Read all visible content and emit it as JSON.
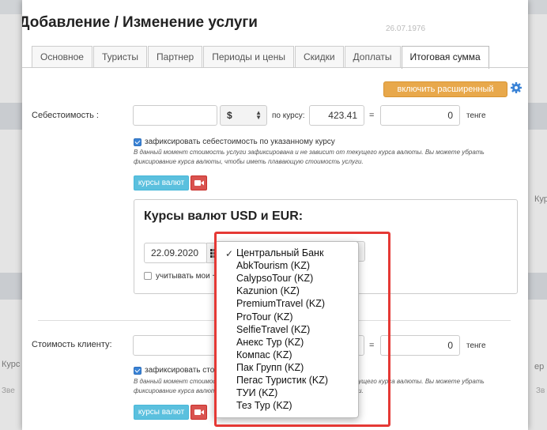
{
  "background": {
    "date": "26.07.1976",
    "left_label_1": "Кур",
    "left_label_2": "Курс",
    "left_label_3": "Зве",
    "right_label_1": "Кур",
    "right_label_2": "ер",
    "right_label_3": "Зв"
  },
  "modal": {
    "title": "Добавление / Изменение услуги",
    "tabs": [
      "Основное",
      "Туристы",
      "Партнер",
      "Периоды и цены",
      "Скидки",
      "Доплаты",
      "Итоговая сумма"
    ],
    "advanced_button": "включить расширенный режим"
  },
  "cost": {
    "label": "Себестоимость :",
    "amount": "",
    "currency": "$",
    "rate_label": "по курсу:",
    "rate": "423.41",
    "equals": "=",
    "total": "0",
    "total_currency": "тенге",
    "fix_label": "зафиксировать себестоимость по указанному курсу",
    "note": "В данный момент стоимость услуги зафиксирована и не зависит от текущего курса валюты. Вы можете убрать фиксирование курса валюты, чтобы иметь плавающую стоимость услуги.",
    "rates_button": "курсы валют"
  },
  "rates_panel": {
    "title": "Курсы валют USD и EUR:",
    "date": "22.09.2020",
    "own_rate_label": "учитывать мои +0 %"
  },
  "client": {
    "label": "Стоимость клиенту:",
    "equals": "=",
    "total": "0",
    "total_currency": "тенге",
    "fix_label": "зафиксировать стоимо",
    "note": "В данный момент стоимость услуги зафиксирована и не зависит от текущего курса валюты. Вы можете убрать фиксирование курса валюты, чтобы иметь плавающую стоимость услуги.",
    "rates_button": "курсы валют"
  },
  "dropdown": {
    "selected_mark": "✓",
    "options": [
      "Центральный Банк",
      "AbkTourism (KZ)",
      "CalypsoTour (KZ)",
      "Kazunion (KZ)",
      "PremiumTravel (KZ)",
      "ProTour (KZ)",
      "SelfieTravel (KZ)",
      "Анекс Тур (KZ)",
      "Компас (KZ)",
      "Пак Групп (KZ)",
      "Пегас Туристик (KZ)",
      "ТУИ (KZ)",
      "Тез Тур (KZ)"
    ]
  },
  "colors": {
    "accent_orange": "#e8a84b",
    "button_blue": "#5bc0de",
    "button_red": "#d9534f",
    "highlight": "#e53935"
  }
}
